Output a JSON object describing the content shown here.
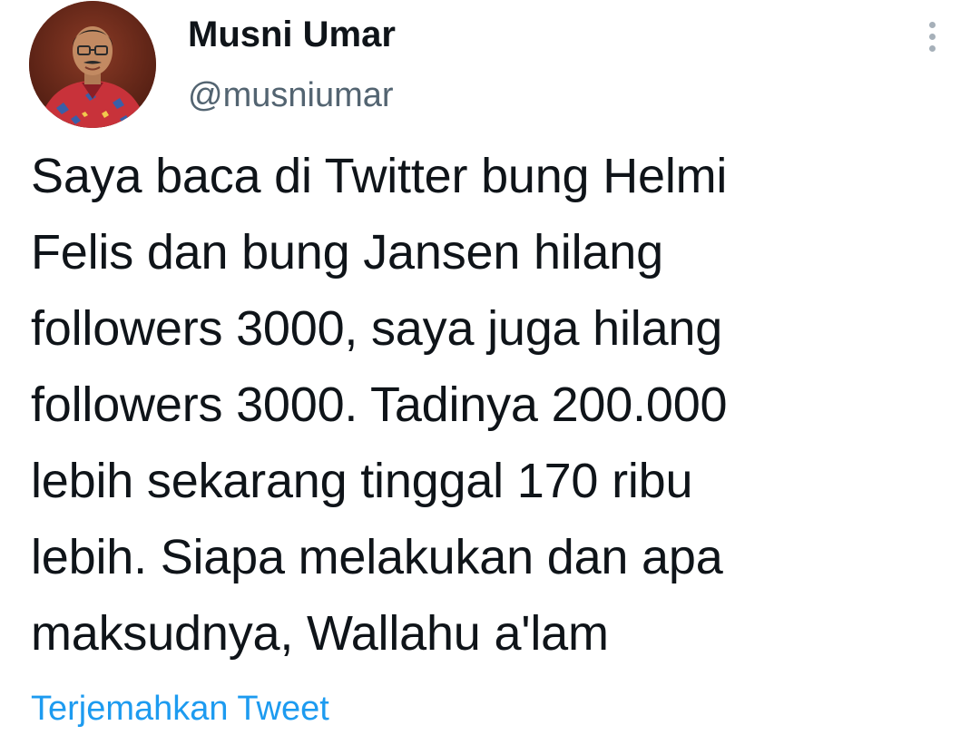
{
  "tweet": {
    "author": {
      "display_name": "Musni Umar",
      "handle": "@musniumar"
    },
    "text_lines": [
      "Saya baca di Twitter bung Helmi",
      "Felis dan bung Jansen hilang",
      "followers 3000, saya juga hilang",
      "followers 3000. Tadinya 200.000",
      "lebih sekarang tinggal 170 ribu",
      "lebih. Siapa melakukan dan apa",
      "maksudnya, Wallahu a'lam"
    ],
    "translate_label": "Terjemahkan Tweet",
    "icons": {
      "more": "more-vertical-icon",
      "avatar": "profile-photo"
    },
    "colors": {
      "text": "#0f1419",
      "secondary": "#536471",
      "link": "#1d9bf0"
    }
  }
}
